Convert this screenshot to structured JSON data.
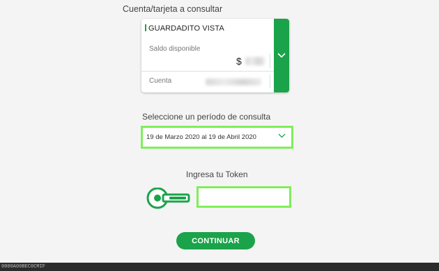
{
  "account_section": {
    "label": "Cuenta/tarjeta a consultar",
    "card": {
      "name": "GUARDADITO VISTA",
      "balance_label": "Saldo disponible",
      "currency_symbol": "$",
      "account_label": "Cuenta"
    }
  },
  "period_section": {
    "label": "Seleccione un período de consulta",
    "selected": "19 de Marzo 2020 al 19 de Abril 2020"
  },
  "token_section": {
    "label": "Ingresa tu Token",
    "value": ""
  },
  "actions": {
    "continue_label": "CONTINUAR"
  },
  "footer": {
    "text": "0000A00BEC0CMIF"
  },
  "colors": {
    "brand_green": "#1aa34a",
    "highlight_green": "#7fee5a",
    "background": "#f4f4f4"
  },
  "icons": {
    "card_expand": "chevron-down-icon",
    "period_dropdown": "chevron-down-icon",
    "token": "key-icon"
  }
}
